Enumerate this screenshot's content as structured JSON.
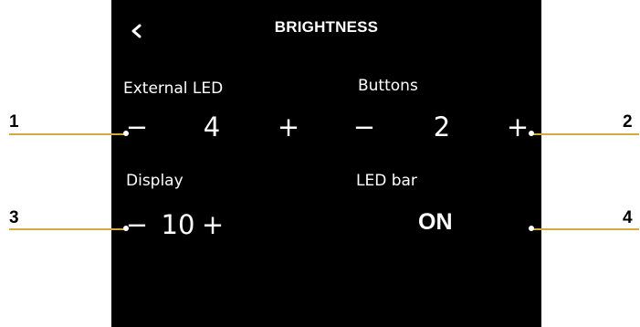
{
  "screen": {
    "title": "BRIGHTNESS",
    "back_icon": "chevron-left-icon"
  },
  "external_led": {
    "label": "External LED",
    "minus": "−",
    "value": "4",
    "plus": "+"
  },
  "buttons": {
    "label": "Buttons",
    "minus": "−",
    "value": "2",
    "plus": "+"
  },
  "display": {
    "label": "Display",
    "minus": "−",
    "value": "10",
    "plus": "+"
  },
  "led_bar": {
    "label": "LED bar",
    "value": "ON"
  },
  "callouts": [
    "1",
    "2",
    "3",
    "4"
  ],
  "colors": {
    "screen_bg": "#000000",
    "text": "#ffffff",
    "callout_line": "#d4a93f",
    "page_bg": "#ffffff"
  }
}
